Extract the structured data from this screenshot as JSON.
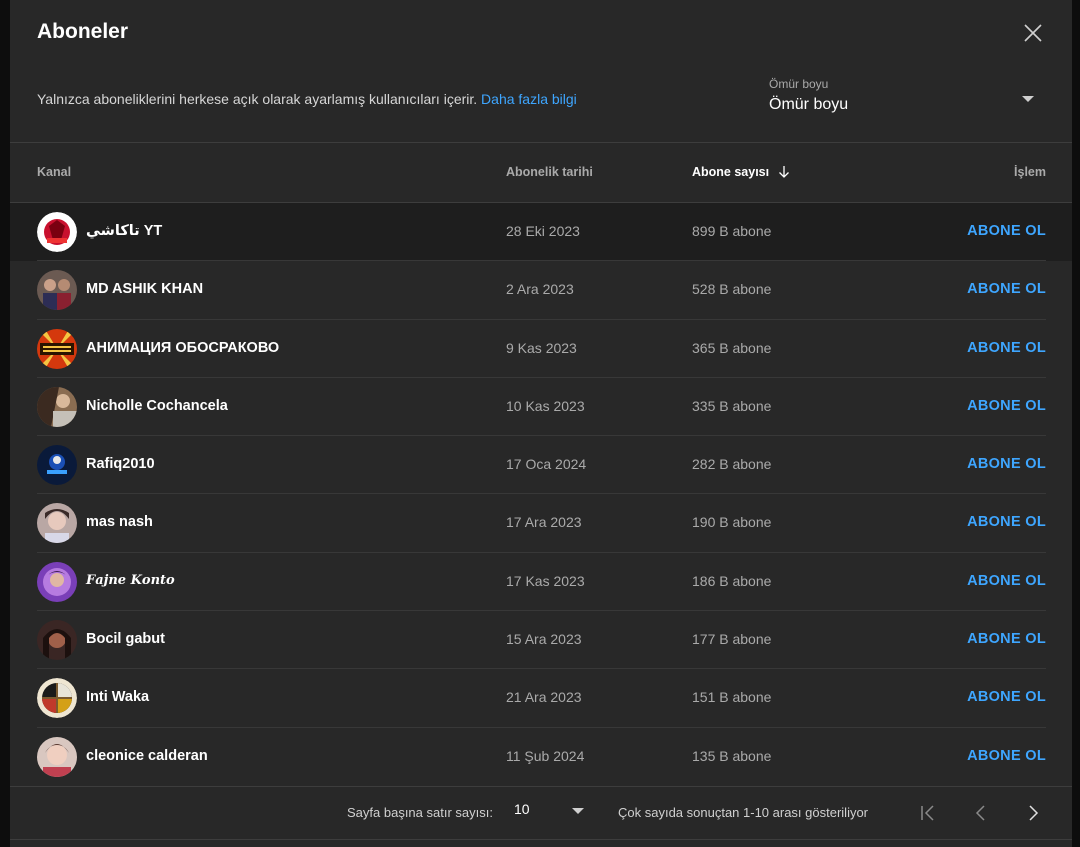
{
  "dialog": {
    "title": "Aboneler",
    "description": "Yalnızca aboneliklerini herkese açık olarak ayarlamış kullanıcıları içerir.",
    "learn_more": "Daha fazla bilgi",
    "period_label": "Ömür boyu",
    "period_value": "Ömür boyu"
  },
  "table": {
    "headers": {
      "channel": "Kanal",
      "date": "Abonelik tarihi",
      "subs": "Abone sayısı",
      "action": "İşlem"
    },
    "rows": [
      {
        "name": "تاكاشي YT",
        "date": "28 Eki 2023",
        "subs": "899 B abone",
        "action": "ABONE OL"
      },
      {
        "name": "MD ASHIK KHAN",
        "date": "2 Ara 2023",
        "subs": "528 B abone",
        "action": "ABONE OL"
      },
      {
        "name": "АНИМАЦИЯ ОБОСРАКОВО",
        "date": "9 Kas 2023",
        "subs": "365 B abone",
        "action": "ABONE OL"
      },
      {
        "name": "Nicholle Cochancela",
        "date": "10 Kas 2023",
        "subs": "335 B abone",
        "action": "ABONE OL"
      },
      {
        "name": "Rafiq2010",
        "date": "17 Oca 2024",
        "subs": "282 B abone",
        "action": "ABONE OL"
      },
      {
        "name": "mas nash",
        "date": "17 Ara 2023",
        "subs": "190 B abone",
        "action": "ABONE OL"
      },
      {
        "name": "𝑭𝒂𝒋𝒏𝒆 𝑲𝒐𝒏𝒕𝒐",
        "date": "17 Kas 2023",
        "subs": "186 B abone",
        "action": "ABONE OL"
      },
      {
        "name": "Bocil gabut",
        "date": "15 Ara 2023",
        "subs": "177 B abone",
        "action": "ABONE OL"
      },
      {
        "name": "Inti Waka",
        "date": "21 Ara 2023",
        "subs": "151 B abone",
        "action": "ABONE OL"
      },
      {
        "name": "cleonice calderan",
        "date": "11 Şub 2024",
        "subs": "135 B abone",
        "action": "ABONE OL"
      }
    ]
  },
  "footer": {
    "rows_per_page_label": "Sayfa başına satır sayısı:",
    "rows_per_page_value": "10",
    "range_text": "Çok sayıda sonuçtan 1-10 arası gösteriliyor"
  },
  "colors": {
    "accent": "#3ea6ff",
    "background": "#282828",
    "highlight_row": "#1e1e1e"
  }
}
